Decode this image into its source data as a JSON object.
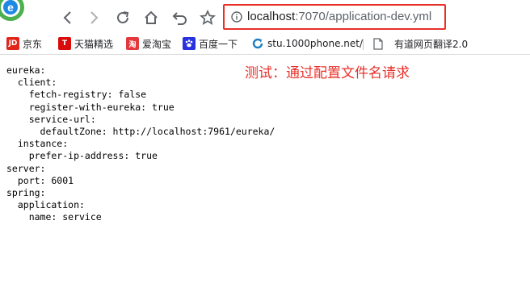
{
  "toolbar": {
    "url_host": "localhost",
    "url_path": ":7070/application-dev.yml"
  },
  "bookmarks": [
    {
      "label": "京东",
      "icon": "jd-icon",
      "icon_text": "JD",
      "color": "#e1251b"
    },
    {
      "label": "天猫精选",
      "icon": "tmall-icon",
      "icon_text": "T",
      "color": "#d90b0b"
    },
    {
      "label": "爱淘宝",
      "icon": "taobao-icon",
      "icon_text": "淘",
      "color": "#e4393c"
    },
    {
      "label": "百度一下",
      "icon": "baidu-paw-icon",
      "icon_text": "",
      "color": "#2932e1"
    },
    {
      "label": "stu.1000phone.net/",
      "icon": "refresh-logo-icon",
      "icon_text": "",
      "color": "#1a7fc1"
    },
    {
      "label": "有道网页翻译2.0",
      "icon": "page-icon",
      "icon_text": "",
      "color": "#5f6368"
    }
  ],
  "document": {
    "lines": [
      "eureka:",
      "  client:",
      "    fetch-registry: false",
      "    register-with-eureka: true",
      "    service-url:",
      "      defaultZone: http://localhost:7961/eureka/",
      "  instance:",
      "    prefer-ip-address: true",
      "server:",
      "  port: 6001",
      "spring:",
      "  application:",
      "    name: service"
    ]
  },
  "annotation": {
    "text": "测试：通过配置文件名请求",
    "color": "#e8302a"
  }
}
